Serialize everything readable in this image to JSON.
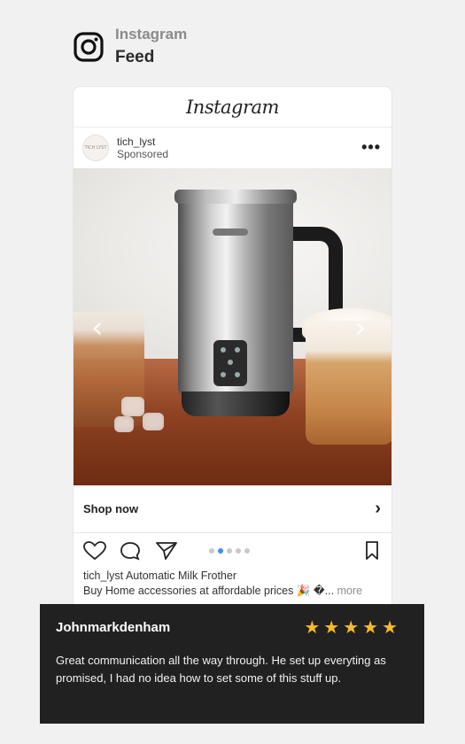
{
  "header": {
    "platform": "Instagram",
    "section": "Feed"
  },
  "post": {
    "brand_wordmark": "Instagram",
    "account_name": "tich_lyst",
    "sponsored_label": "Sponsored",
    "avatar_text": "TICH LYST",
    "more_icon": "more-horizontal-icon",
    "shop_label": "Shop now",
    "carousel_total": 5,
    "carousel_active": 2,
    "caption_user": "tich_lyst",
    "caption_title": "Automatic Milk Frother",
    "caption_body": "Buy Home accessories at affordable prices 🎉 �... ",
    "caption_more": "more"
  },
  "review": {
    "reviewer": "Johnmarkdenham",
    "rating": 5,
    "star_color": "#f7bb27",
    "text": "Great communication all the way through. He set up everyting as promised, I had no idea how to set some of this stuff up."
  }
}
